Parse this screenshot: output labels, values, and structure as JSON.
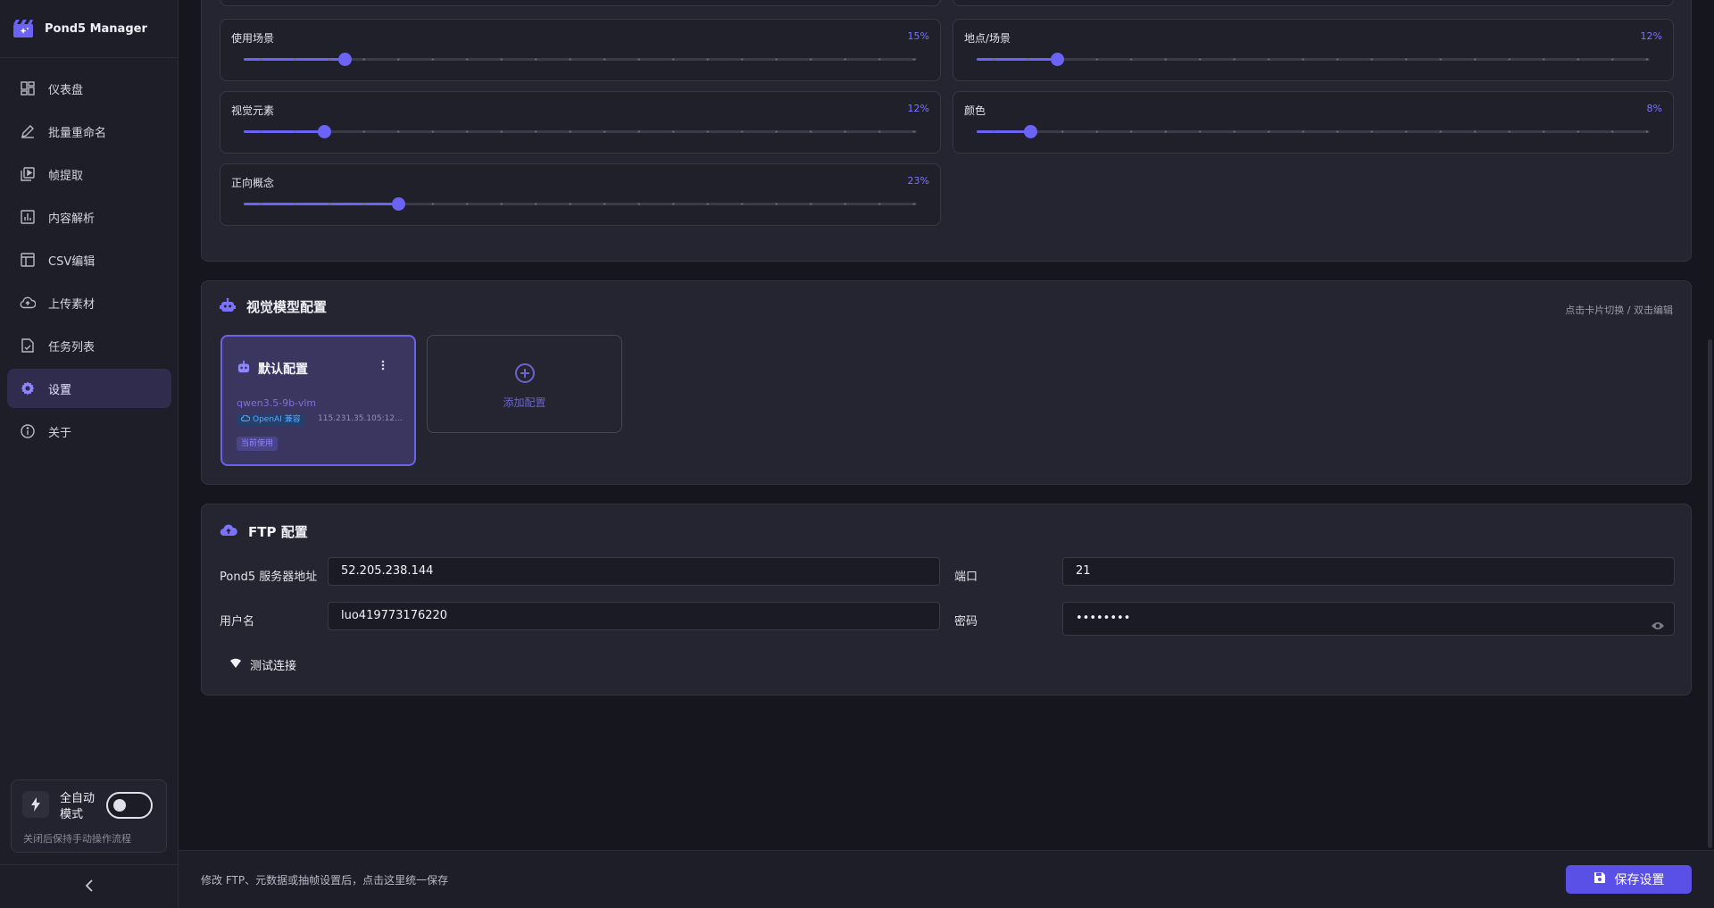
{
  "app": {
    "name": "Pond5 Manager"
  },
  "sidebar": {
    "items": [
      {
        "label": "仪表盘",
        "icon": "dashboard-icon"
      },
      {
        "label": "批量重命名",
        "icon": "edit-icon"
      },
      {
        "label": "帧提取",
        "icon": "video-frame-icon"
      },
      {
        "label": "内容解析",
        "icon": "analytics-icon"
      },
      {
        "label": "CSV编辑",
        "icon": "table-icon"
      },
      {
        "label": "上传素材",
        "icon": "cloud-upload-icon"
      },
      {
        "label": "任务列表",
        "icon": "task-list-icon"
      },
      {
        "label": "设置",
        "icon": "gear-icon",
        "active": true
      },
      {
        "label": "关于",
        "icon": "info-icon"
      }
    ],
    "auto_mode": {
      "title": "全自动模式",
      "description": "关闭后保持手动操作流程",
      "enabled": false
    }
  },
  "weights": {
    "items": [
      {
        "label": "使用场景",
        "value": "15%",
        "level": 15
      },
      {
        "label": "地点/场景",
        "value": "12%",
        "level": 12
      },
      {
        "label": "视觉元素",
        "value": "12%",
        "level": 12
      },
      {
        "label": "颜色",
        "value": "8%",
        "level": 8
      },
      {
        "label": "正向概念",
        "value": "23%",
        "level": 23
      }
    ]
  },
  "vision_model": {
    "title": "视觉模型配置",
    "hint": "点击卡片切换 / 双击编辑",
    "card": {
      "title": "默认配置",
      "model": "qwen3.5-9b-vlm",
      "compat": "OpenAI 兼容",
      "endpoint": "115.231.35.105:12...",
      "status": "当前使用"
    },
    "add_label": "添加配置"
  },
  "ftp": {
    "title": "FTP 配置",
    "server_label": "Pond5 服务器地址",
    "server_value": "52.205.238.144",
    "port_label": "端口",
    "port_value": "21",
    "user_label": "用户名",
    "user_value": "luo419773176220",
    "password_label": "密码",
    "password_value": "••••••••",
    "test_button": "测试连接"
  },
  "footer": {
    "note": "修改 FTP、元数据或抽帧设置后，点击这里统一保存",
    "save_button": "保存设置"
  },
  "colors": {
    "accent": "#6b63f5",
    "background": "#16161f",
    "panel": "#252531"
  }
}
